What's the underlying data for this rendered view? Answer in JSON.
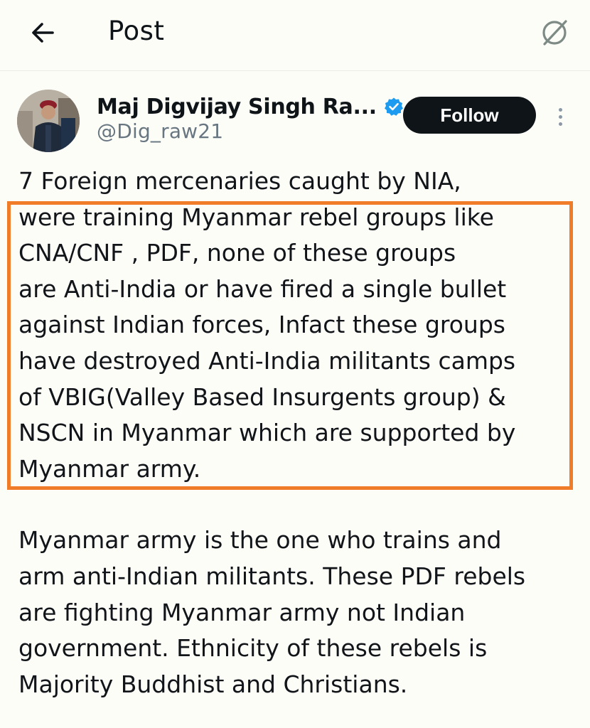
{
  "header": {
    "title": "Post",
    "back_icon": "arrow-left-icon",
    "grok_icon": "slashed-circle-icon"
  },
  "author": {
    "display_name": "Maj Digvijay Singh Ra...",
    "handle": "@Dig_raw21",
    "verified": true,
    "verified_color": "#1d9bf0"
  },
  "actions": {
    "follow_label": "Follow"
  },
  "post": {
    "paragraph1": [
      "7 Foreign mercenaries caught by NIA,",
      "were training Myanmar rebel groups like",
      "CNA/CNF , PDF, none of these groups",
      "are Anti-India or have fired a single bullet",
      "against Indian forces, Infact these groups",
      "have destroyed Anti-India militants camps",
      "of VBIG(Valley Based Insurgents group) &",
      "NSCN in Myanmar which are supported by",
      "Myanmar army."
    ],
    "paragraph2": [
      "Myanmar army is the one who trains and",
      "arm anti-Indian militants. These PDF rebels",
      "are fighting Myanmar army not Indian",
      "government. Ethnicity of these rebels is",
      "Majority Buddhist and Christians."
    ]
  },
  "annotation": {
    "highlight_color": "#f07c2a"
  }
}
